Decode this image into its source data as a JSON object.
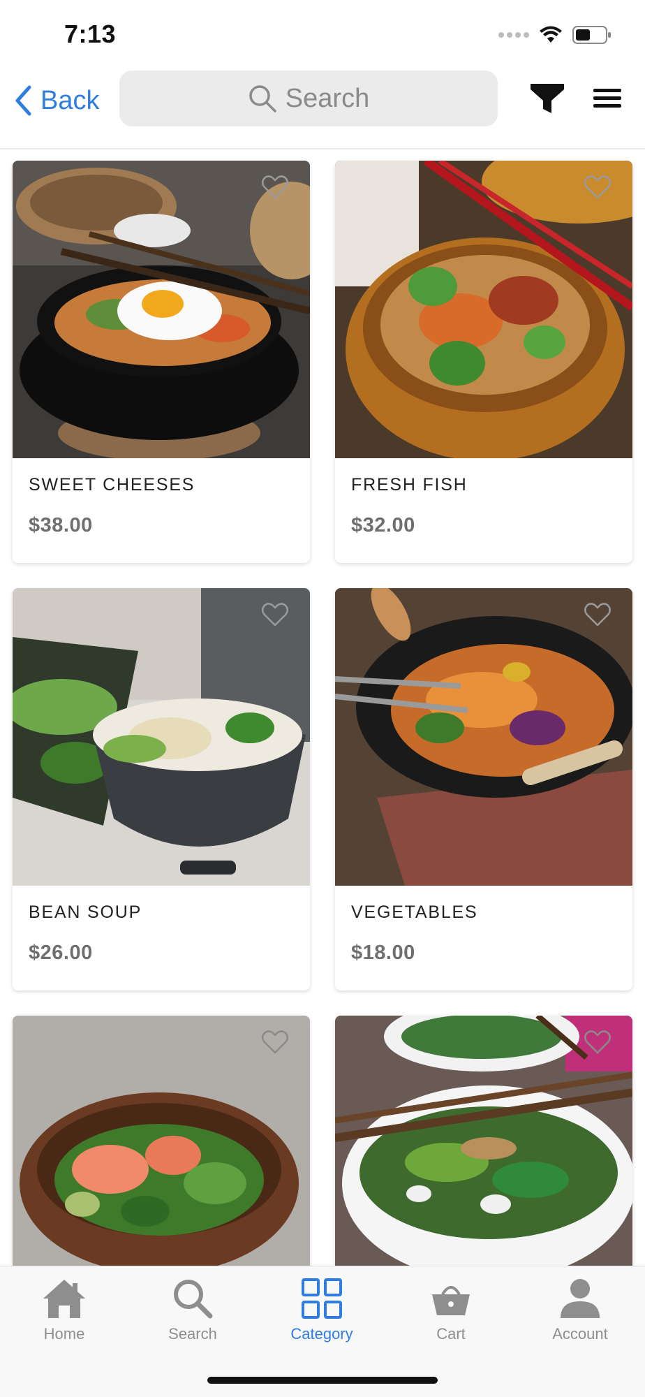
{
  "status_bar": {
    "time": "7:13"
  },
  "header": {
    "back_label": "Back",
    "search_placeholder": "Search",
    "icons": {
      "back": "chevron-left-icon",
      "search": "search-icon",
      "filter": "filter-icon",
      "menu": "hamburger-menu-icon"
    }
  },
  "products": [
    {
      "name": "SWEET CHEESES",
      "price": "$38.00",
      "image": "bibimbap-stone-bowl"
    },
    {
      "name": "FRESH FISH",
      "price": "$32.00",
      "image": "noodles-wooden-bowl"
    },
    {
      "name": "BEAN SOUP",
      "price": "$26.00",
      "image": "ramen-dark-bowl"
    },
    {
      "name": "VEGETABLES",
      "price": "$18.00",
      "image": "noodles-in-wok"
    },
    {
      "name": "",
      "price": "",
      "image": "salmon-salad-bowl"
    },
    {
      "name": "",
      "price": "",
      "image": "green-soup-white-bowl"
    }
  ],
  "tabbar": {
    "tabs": [
      {
        "label": "Home",
        "icon": "home-icon",
        "active": false
      },
      {
        "label": "Search",
        "icon": "search-icon",
        "active": false
      },
      {
        "label": "Category",
        "icon": "grid-icon",
        "active": true
      },
      {
        "label": "Cart",
        "icon": "basket-icon",
        "active": false
      },
      {
        "label": "Account",
        "icon": "user-icon",
        "active": false
      }
    ]
  },
  "colors": {
    "accent": "#2f7de1",
    "tab_inactive": "#8e8e8e",
    "price": "#6f6f6f",
    "search_bg": "#ebebeb"
  }
}
